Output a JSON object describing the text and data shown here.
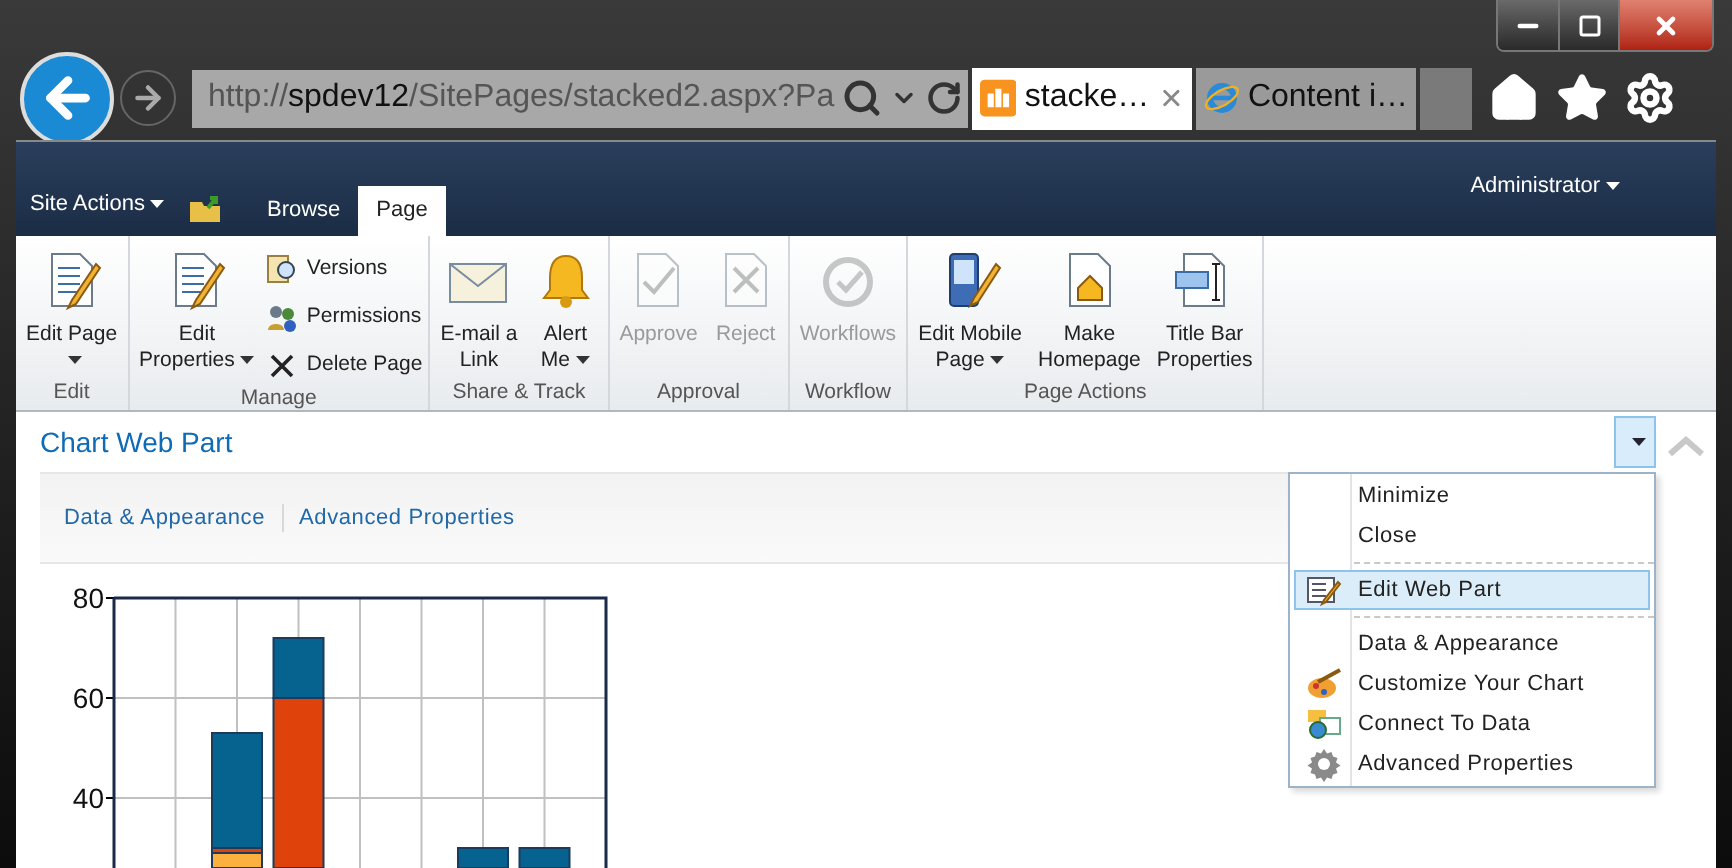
{
  "browser": {
    "address": {
      "scheme": "http://",
      "host": "spdev12",
      "path": "/SitePages/stacked2.aspx?Pa"
    },
    "tabs": [
      {
        "label": "stacke…",
        "selected": true
      },
      {
        "label": "Content i…",
        "selected": false
      }
    ]
  },
  "site_bar": {
    "site_actions": "Site Actions",
    "tabs": [
      {
        "label": "Browse",
        "selected": false
      },
      {
        "label": "Page",
        "selected": true
      }
    ],
    "user": "Administrator"
  },
  "ribbon": {
    "groups": [
      {
        "label": "Edit",
        "buttons": [
          {
            "kind": "large",
            "lines": [
              "Edit Page"
            ],
            "dropdown": true,
            "disabled": false
          }
        ]
      },
      {
        "label": "Manage",
        "buttons": [
          {
            "kind": "large",
            "lines": [
              "Edit",
              "Properties"
            ],
            "dropdown": true,
            "disabled": false
          },
          {
            "kind": "small",
            "lines": [
              "Versions"
            ],
            "dropdown": false,
            "disabled": false
          },
          {
            "kind": "small",
            "lines": [
              "Permissions"
            ],
            "dropdown": false,
            "disabled": false
          },
          {
            "kind": "small",
            "lines": [
              "Delete Page"
            ],
            "dropdown": false,
            "disabled": false
          }
        ]
      },
      {
        "label": "Share & Track",
        "buttons": [
          {
            "kind": "large",
            "lines": [
              "E-mail a",
              "Link"
            ],
            "dropdown": false,
            "disabled": false
          },
          {
            "kind": "large",
            "lines": [
              "Alert",
              "Me"
            ],
            "dropdown": true,
            "disabled": false
          }
        ]
      },
      {
        "label": "Approval",
        "buttons": [
          {
            "kind": "large",
            "lines": [
              "Approve"
            ],
            "dropdown": false,
            "disabled": true
          },
          {
            "kind": "large",
            "lines": [
              "Reject"
            ],
            "dropdown": false,
            "disabled": true
          }
        ]
      },
      {
        "label": "Workflow",
        "buttons": [
          {
            "kind": "large",
            "lines": [
              "Workflows"
            ],
            "dropdown": false,
            "disabled": true
          }
        ]
      },
      {
        "label": "Page Actions",
        "buttons": [
          {
            "kind": "large",
            "lines": [
              "Edit Mobile",
              "Page"
            ],
            "dropdown": true,
            "disabled": false
          },
          {
            "kind": "large",
            "lines": [
              "Make",
              "Homepage"
            ],
            "dropdown": false,
            "disabled": false
          },
          {
            "kind": "large",
            "lines": [
              "Title Bar",
              "Properties"
            ],
            "dropdown": false,
            "disabled": false
          }
        ]
      }
    ]
  },
  "web_part": {
    "title": "Chart Web Part",
    "menu_open": true,
    "toolbar": [
      "Data & Appearance",
      "Advanced Properties"
    ],
    "menu": [
      {
        "kind": "item",
        "label": "Minimize",
        "selected": false
      },
      {
        "kind": "item",
        "label": "Close",
        "selected": false
      },
      {
        "kind": "separator"
      },
      {
        "kind": "item",
        "label": "Edit Web Part",
        "selected": true
      },
      {
        "kind": "separator"
      },
      {
        "kind": "item",
        "label": "Data & Appearance",
        "selected": false
      },
      {
        "kind": "item",
        "label": "Customize Your Chart",
        "selected": false
      },
      {
        "kind": "item",
        "label": "Connect To Data",
        "selected": false
      },
      {
        "kind": "item",
        "label": "Advanced Properties",
        "selected": false
      }
    ],
    "chart": {
      "kind": "picture",
      "axis_labels": [
        "80",
        "60",
        "40"
      ]
    }
  }
}
